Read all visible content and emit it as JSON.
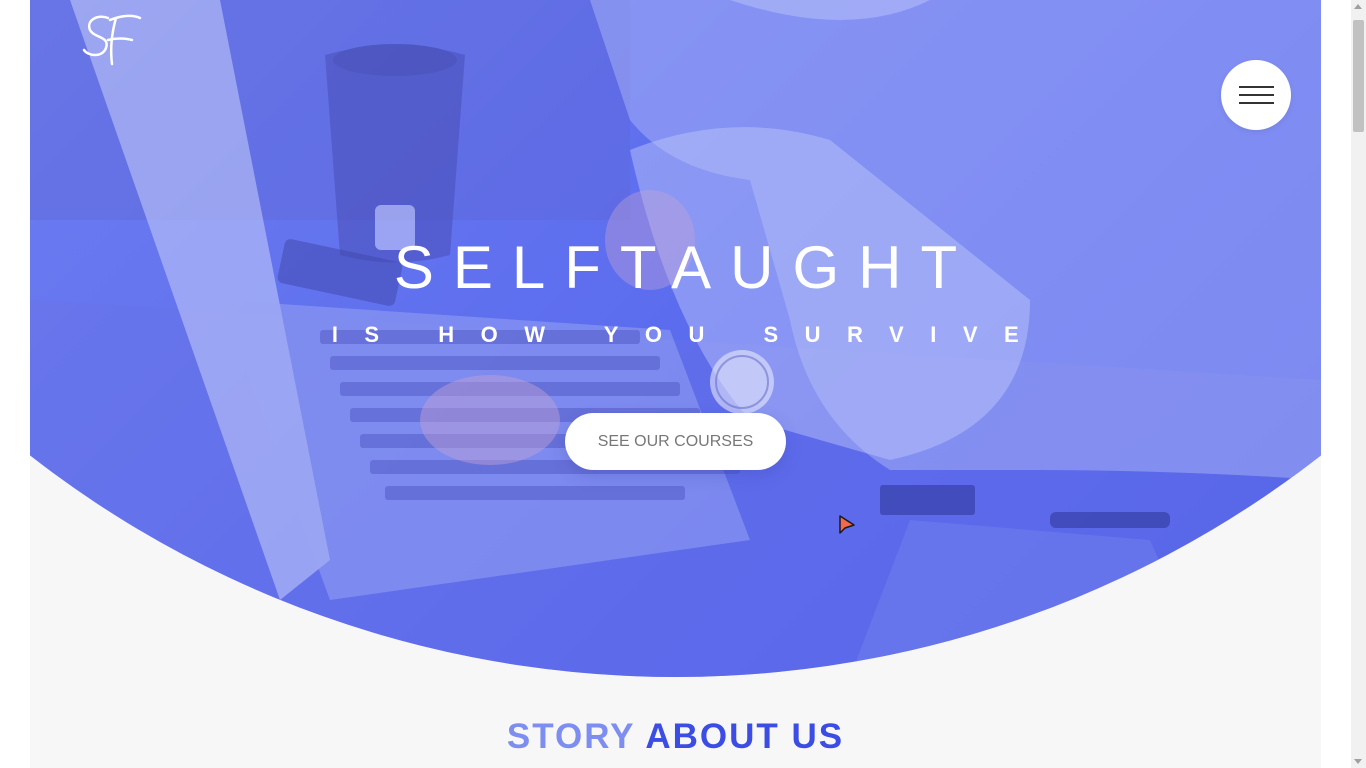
{
  "site": {
    "brand_mark": "SF"
  },
  "header": {
    "menu_icon": "hamburger-icon"
  },
  "hero": {
    "title": "SELFTAUGHT",
    "subtitle": "IS HOW YOU SURVIVE",
    "cta_label": "SEE OUR COURSES",
    "image": "laptop-typing-photo"
  },
  "story": {
    "heading_part1": "STORY",
    "heading_part2": "ABOUT US"
  },
  "colors": {
    "hero_overlay": "#6f7ff0",
    "heading_light": "#7e8ef0",
    "heading_dark": "#3b4de4",
    "background": "#f7f7f7"
  }
}
